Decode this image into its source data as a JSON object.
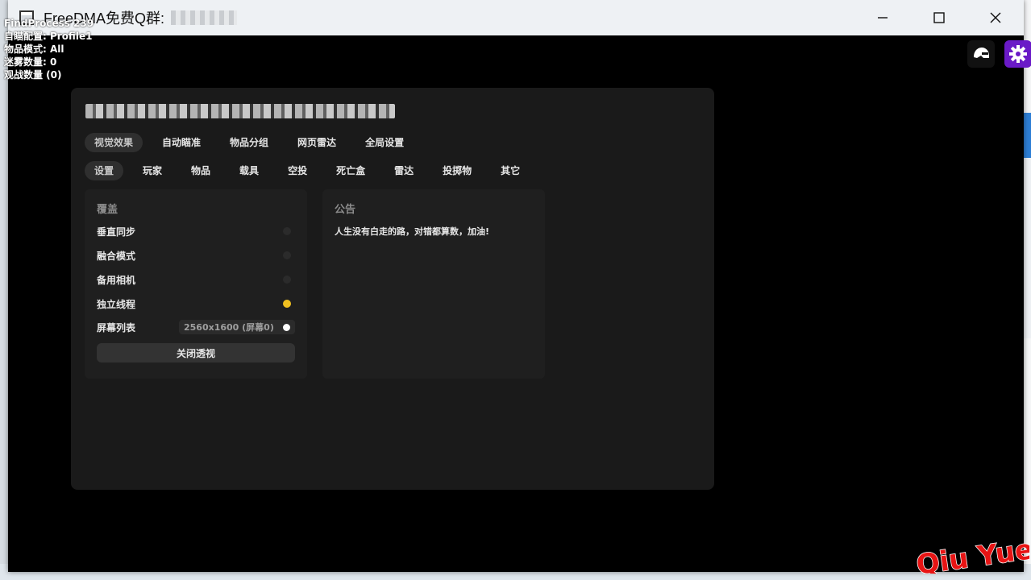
{
  "window": {
    "title": "FreeDMA免费Q群:",
    "controls": {
      "minimize": "—",
      "maximize": "□",
      "close": "✕"
    }
  },
  "overlay": {
    "lines": [
      "FindProcess 239",
      "自瞄配置: Profile1",
      "物品模式: All",
      "迷雾数量: 0",
      "观战数量 (0)"
    ]
  },
  "main_tabs": [
    {
      "label": "视觉效果",
      "active": true
    },
    {
      "label": "自动瞄准",
      "active": false
    },
    {
      "label": "物品分组",
      "active": false
    },
    {
      "label": "网页雷达",
      "active": false
    },
    {
      "label": "全局设置",
      "active": false
    }
  ],
  "sub_tabs": [
    {
      "label": "设置",
      "active": true
    },
    {
      "label": "玩家",
      "active": false
    },
    {
      "label": "物品",
      "active": false
    },
    {
      "label": "载具",
      "active": false
    },
    {
      "label": "空投",
      "active": false
    },
    {
      "label": "死亡盒",
      "active": false
    },
    {
      "label": "雷达",
      "active": false
    },
    {
      "label": "投掷物",
      "active": false
    },
    {
      "label": "其它",
      "active": false
    }
  ],
  "overlay_card": {
    "heading": "覆盖",
    "toggles": [
      {
        "label": "垂直同步",
        "on": false
      },
      {
        "label": "融合模式",
        "on": false
      },
      {
        "label": "备用相机",
        "on": false
      },
      {
        "label": "独立线程",
        "on": true
      }
    ],
    "screen_list": {
      "label": "屏幕列表",
      "value": "2560x1600 (屏幕0)"
    },
    "close_button": "关闭透视"
  },
  "notice_card": {
    "heading": "公告",
    "text": "人生没有白走的路，对错都算数，加油!"
  },
  "watermark": "Qiu Yue",
  "colors": {
    "accent_toggle": "#f0c020",
    "gear_button": "#6a1ac7",
    "watermark": "#e81414"
  }
}
